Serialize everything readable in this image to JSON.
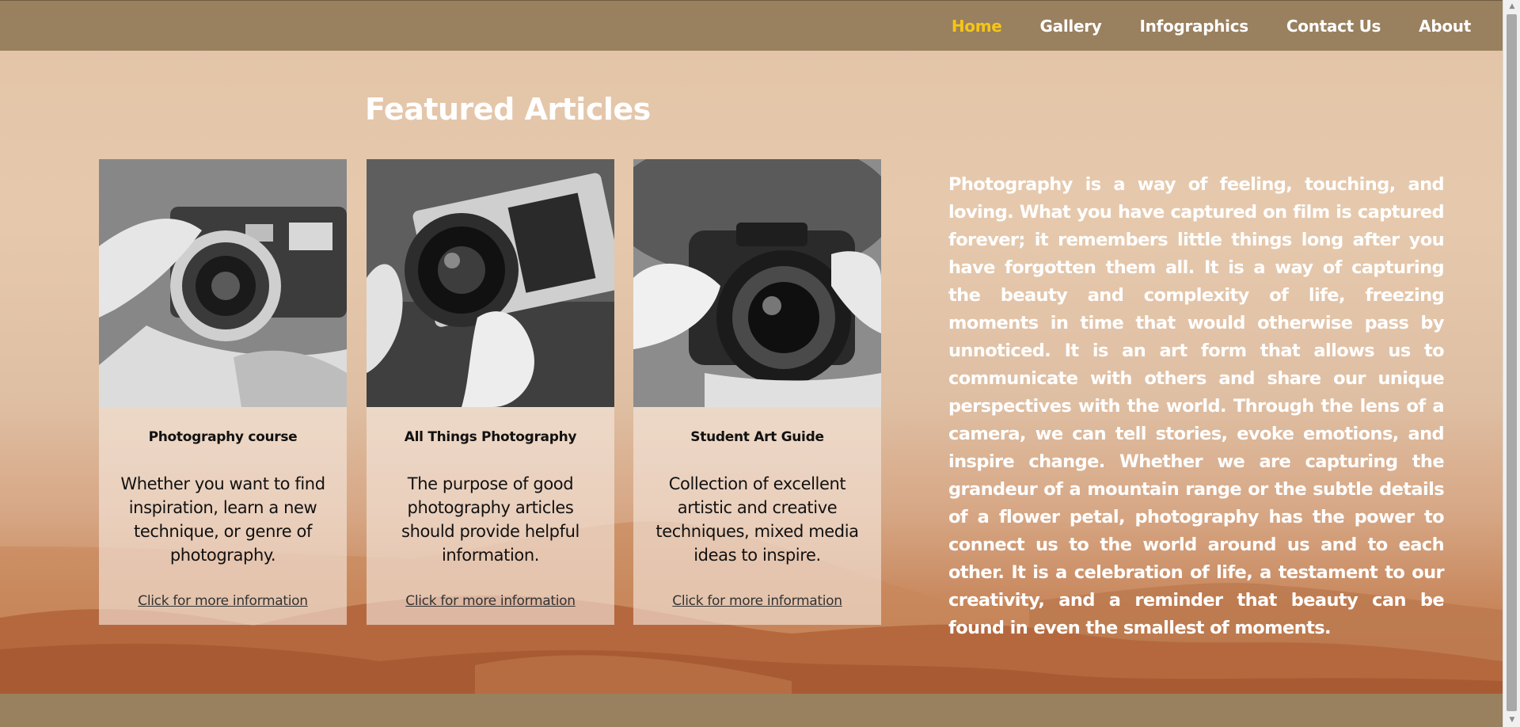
{
  "nav": {
    "items": [
      {
        "label": "Home",
        "active": true
      },
      {
        "label": "Gallery",
        "active": false
      },
      {
        "label": "Infographics",
        "active": false
      },
      {
        "label": "Contact Us",
        "active": false
      },
      {
        "label": "About",
        "active": false
      }
    ],
    "active_color": "#f5c518",
    "bar_color": "#99805e"
  },
  "featured": {
    "heading": "Featured Articles",
    "cards": [
      {
        "image_icon": "camera-lens-in-hands-photo",
        "title": "Photography course",
        "description": "Whether you want to find inspiration, learn a new technique, or genre of photography.",
        "link": "Click for more information"
      },
      {
        "image_icon": "film-camera-in-hand-photo",
        "title": "All Things Photography",
        "description": "The purpose of good photography articles should provide helpful information.",
        "link": "Click for more information"
      },
      {
        "image_icon": "person-holding-camera-photo",
        "title": "Student Art Guide",
        "description": "Collection of excellent artistic and creative techniques, mixed media ideas to inspire.",
        "link": "Click for more information"
      }
    ]
  },
  "quote": {
    "text": "Photography is a way of feeling, touching, and loving. What you have captured on film is captured forever; it remembers little things long after you have forgotten them all. It is a way of capturing the beauty and complexity of life, freezing moments in time that would otherwise pass by unnoticed. It is an art form that allows us to communicate with others and share our unique perspectives with the world. Through the lens of a camera, we can tell stories, evoke emotions, and inspire change. Whether we are capturing the grandeur of a mountain range or the subtle details of a flower petal, photography has the power to connect us to the world around us and to each other. It is a celebration of life, a testament to our creativity, and a reminder that beauty can be found in even the smallest of moments."
  },
  "footer": {
    "color": "#99805e"
  }
}
